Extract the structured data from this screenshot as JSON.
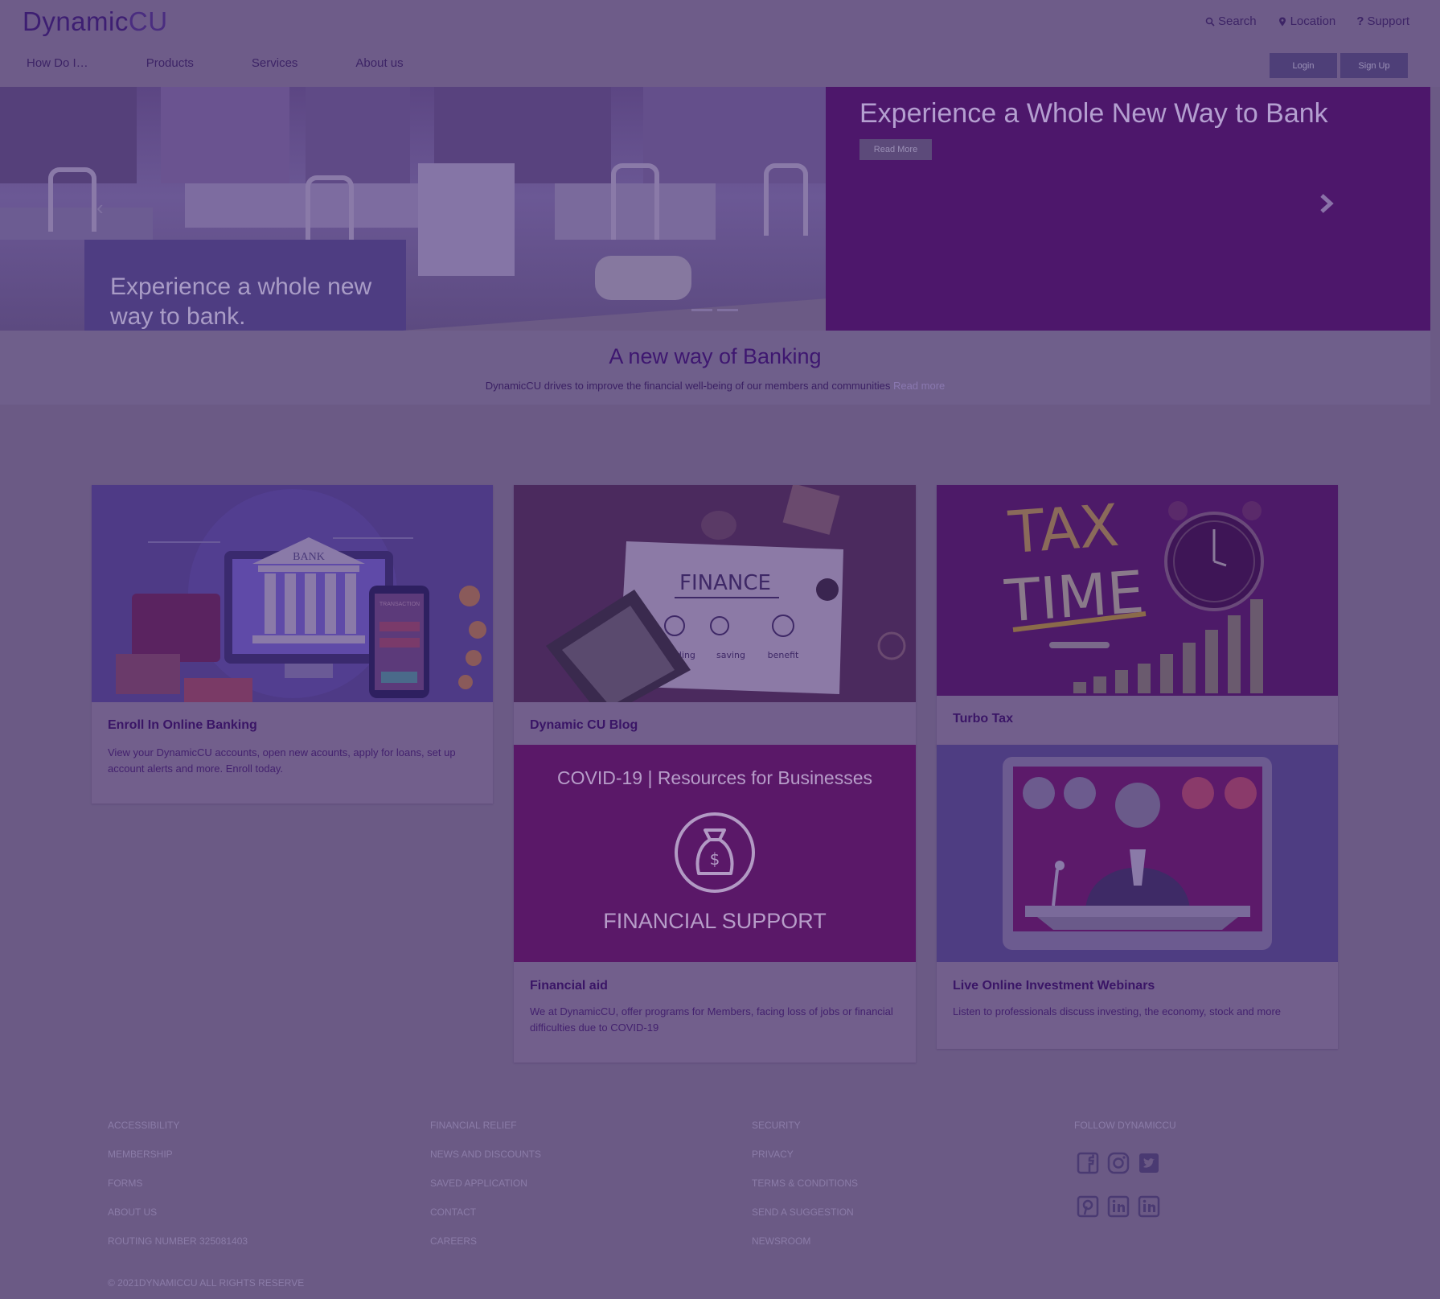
{
  "brand": {
    "name_main": "Dynamic",
    "name_accent": "CU"
  },
  "utility_nav": [
    {
      "label": "Search",
      "icon": "search-icon"
    },
    {
      "label": "Location",
      "icon": "location-pin-icon"
    },
    {
      "label": "Support",
      "icon": "question-icon"
    }
  ],
  "main_nav": [
    "How Do I…",
    "Products",
    "Services",
    "About us"
  ],
  "auth": {
    "login": "Login",
    "signup": "Sign Up"
  },
  "hero": {
    "image_caption": "Experience a whole new way to bank.",
    "title": "Experience a Whole New Way to Bank",
    "read_more": "Read More"
  },
  "intro": {
    "heading": "A new way of Banking",
    "text": "DynamicCU drives to improve the financial well-being of our members and communities",
    "link": "Read more"
  },
  "cards": {
    "online_banking": {
      "title": "Enroll In Online Banking",
      "text": "View your DynamicCU accounts, open new acounts, apply for loans, set up account alerts and more. Enroll today.",
      "image_text": {
        "bank": "BANK",
        "transaction": "TRANSACTION"
      }
    },
    "blog": {
      "title": "Dynamic CU Blog",
      "image_text": {
        "finance": "FINANCE",
        "funding": "funding",
        "saving": "saving",
        "benefit": "benefit"
      }
    },
    "turbo_tax": {
      "title": "Turbo Tax",
      "image_text": {
        "line1": "TAX",
        "line2": "TIME"
      }
    },
    "financial_aid": {
      "title": "Financial aid",
      "text": "We at DynamicCU, offer programs for Members, facing loss of jobs or financial difficulties due to COVID-19",
      "image_text": {
        "header": "COVID-19 | Resources for Businesses",
        "footer": "FINANCIAL SUPPORT"
      }
    },
    "webinars": {
      "title": "Live Online Investment Webinars",
      "text": "Listen to professionals discuss investing, the economy, stock and more"
    }
  },
  "footer": {
    "col1": [
      "ACCESSIBILITY",
      "MEMBERSHIP",
      "FORMS",
      "ABOUT US",
      "ROUTING NUMBER 325081403"
    ],
    "col2": [
      "FINANCIAL RELIEF",
      "NEWS AND DISCOUNTS",
      "SAVED APPLICATION",
      "CONTACT",
      "CAREERS"
    ],
    "col3": [
      "SECURITY",
      "PRIVACY",
      "TERMS & CONDITIONS",
      "SEND A SUGGESTION",
      "NEWSROOM"
    ],
    "follow_label": "FOLLOW DYNAMICCU",
    "social": [
      "facebook-icon",
      "instagram-icon",
      "twitter-icon",
      "pinterest-icon",
      "linkedin-icon",
      "linkedin-icon"
    ],
    "copyright": "© 2021DYNAMICCU ALL RIGHTS RESERVE"
  },
  "colors": {
    "overlay": "#6b5a85",
    "brand_purple": "#4d176b",
    "magenta_panel": "#5a1868"
  }
}
